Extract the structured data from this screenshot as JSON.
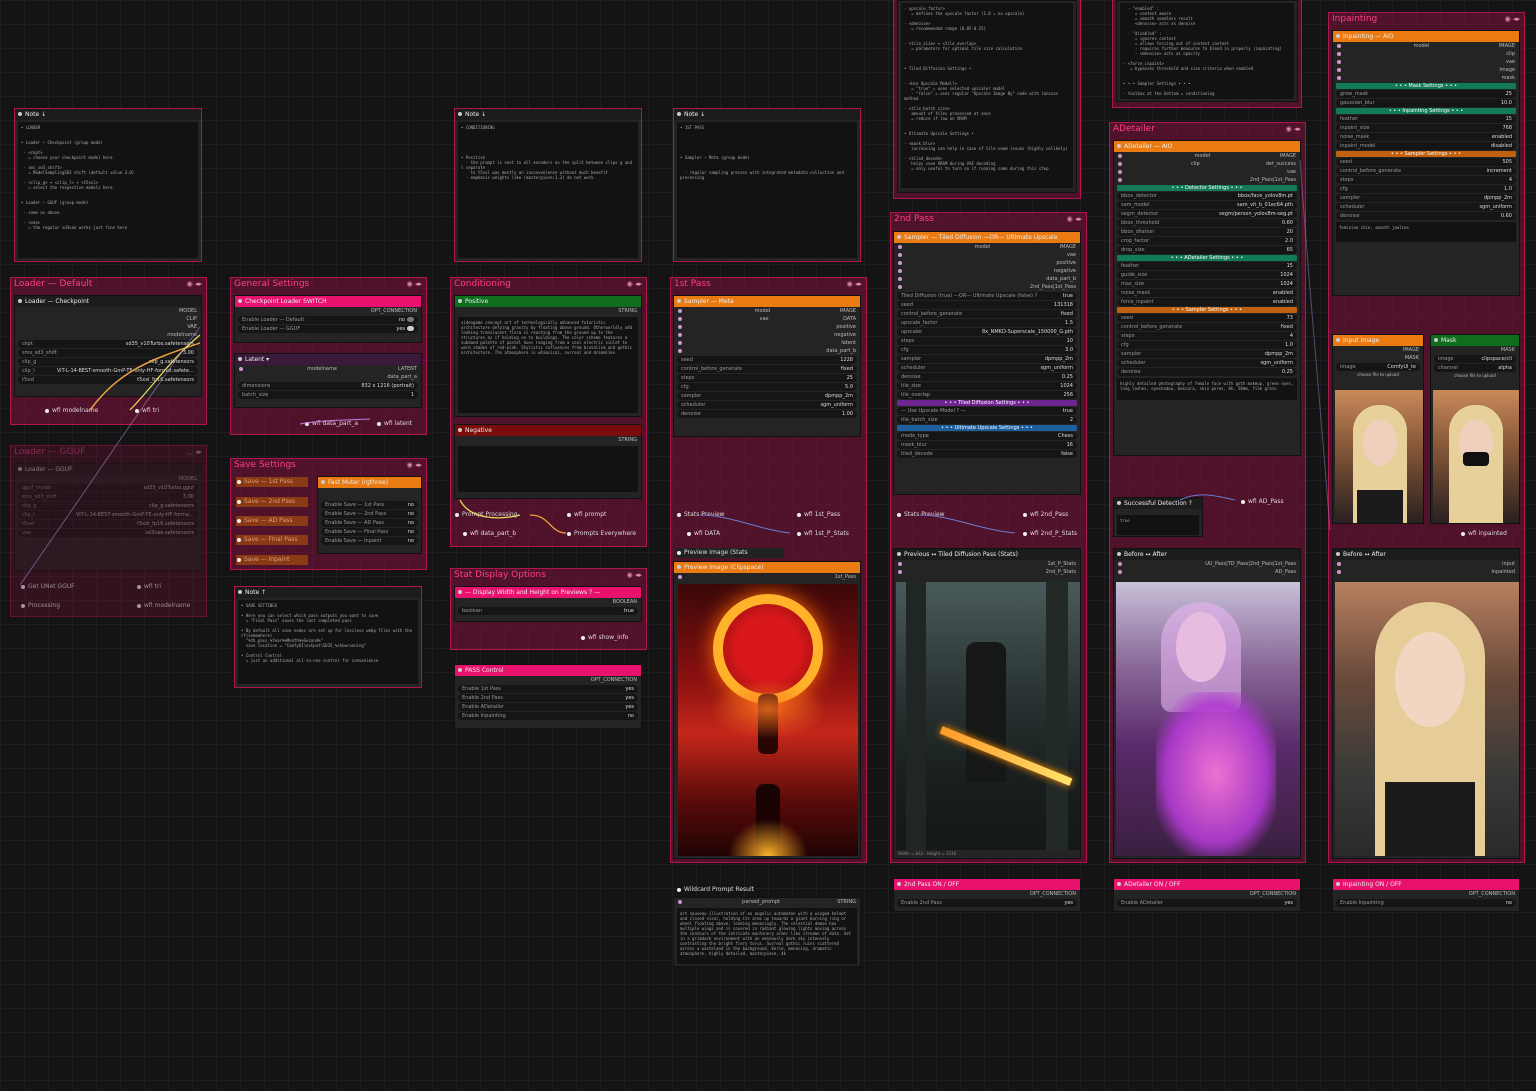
{
  "groups": {
    "loader_default": "Loader — Default",
    "loader_gguf": "Loader — GGUF",
    "general": "General Settings",
    "save": "Save Settings",
    "conditioning": "Conditioning",
    "stat": "Stat Display Options",
    "pass1": "1st Pass",
    "pass2": "2nd Pass",
    "adetailer": "ADetailer",
    "inpainting": "Inpainting"
  },
  "notes": {
    "note1": {
      "title": "Note ↓",
      "text": "• LOADER\n\n\n• Loader — Checkpoint (group mode)\n\n - <ckpt>\n   = choose your checkpoint model here\n\n - sms_sd3_shift>\n   = ModelSamplingSD3 shift (default value 3.0)\n\n - <clip_g> + <clip_l> + <t5xxl>\n   = select the respective models here\n\n\n• Loader — GGUF (group mode)\n\n - same as above\n\n - <vae>\n   = the regular sd3vae works just fine here"
    },
    "note2": {
      "title": "Note ↓",
      "text": "• CONDITIONING\n\n\n\n\n\n• Positive\n  - the prompt is sent to all encoders as the split between clips g and l separate\n    to t5xxl was mostly an inconvenience without much benefit\n  - emphasis weights like (masterpiece:1.3) do not work"
    },
    "note3": {
      "title": "Note ↓",
      "text": "• 1ST PASS\n\n\n\n\n\n• Sampler — Meta (group mode)\n\n\n  - regular sampling process with integrated metadata collection and processing"
    },
    "note4": {
      "title": "Note ↑",
      "text": "• SAVE SETTINGS\n\n• Here you can select which pass outputs you want to save\n  = \"Final Pass\" saves the last completed pass\n\n• By default all save nodes are set up for lossless webp files with the rf(somewhere)\n  \"%th_pass_%Year%%Month%%Second%\"\n  save location = \"ComfyUI\\output\\SD35_%showrunning\"\n\n• Control Control\n  = just an additional all-in-one control for convenience"
    },
    "note5": {
      "title": "",
      "text": "- upscale_factor>\n   = defines the upscale factor (1.0 = no upscale)\n\n- <denoise>\n   = recommended range (0.05-0.25)\n\n\n- <tile_size> + <tile_overlap>\n   = parameters for optimal tile size calculation\n\n\n\n• Tiled Diffusion Settings •\n\n\n- <Use Upscale Model?>\n   = \"true\" = uses selected upscaler model\n   - \"false\" = uses regular \"Upscale Image By\" node with lanczos method\n\n- <tile_batch_size>\n   amount of tiles processed at once\n   = reduce if low on VRAM\n\n\n• Ultimate Upscale Settings •\n\n- <mask_blur>\n   increasing can help in case of tile-seam issues (highly unlikely)\n\n- <tiled_decode>\n   helps save VRAM during VAE decoding\n   = only useful to turn on if running some during this step"
    },
    "note6": {
      "title": "",
      "text": "  - \"enabled\" :\n     = context aware\n     = smooth seamless result\n     <denoise> acts as denoise\n\n  - \"disabled\" :\n     = ignores context\n     = allows forcing out of context content\n     - requires further measures to blend in properly (inpainting)\n     - <denoise> acts as opacity\n\n- <force_inpaint>\n   = bypasses threshold and size criteria when enabled\n\n\n• • • Sampler Settings • • •\n\n- toolbox at the bottom = conditioning"
    }
  },
  "loader_ckpt": {
    "title": "Loader — Checkpoint",
    "outputs": [
      "MODEL",
      "CLIP",
      "VAE",
      "modelname"
    ],
    "widgets": [
      [
        "ckpt",
        "sd35_v10Turbo.safetensors"
      ],
      [
        "sms_sd3_shift",
        "3.00"
      ],
      [
        "clip_g",
        "clip_g.safetensors"
      ],
      [
        "clip_l",
        "ViT-L-14-BEST-smooth-GmP-TE-only-HF-format.safete…"
      ],
      [
        "t5xxl",
        "t5xxl_fp16.safetensors"
      ]
    ],
    "pills": [
      "wfi modelname",
      "wfi tri"
    ]
  },
  "loader_gguf": {
    "title": "Loader — GGUF",
    "outputs": [
      "MODEL"
    ],
    "widgets": [
      [
        "gguf_model",
        "sd35_v10Turbo.gguf"
      ],
      [
        "sms_sd3_shift",
        "3.00"
      ],
      [
        "clip_g",
        "clip_g.safetensors"
      ],
      [
        "clip_l",
        "ViT-L-14-BEST-smooth-GmP-TE-only-HF-forma…"
      ],
      [
        "t5xxl",
        "t5xxl_fp16.safetensors"
      ],
      [
        "vae",
        "sd3vae.safetensors"
      ]
    ],
    "pills": [
      "Get UNet GGUF",
      "wfi tri",
      "Processing",
      "wfi modelname"
    ]
  },
  "ckpt_switch": {
    "title": "Checkpoint Loader SWITCH",
    "out": "OPT_CONNECTION",
    "toggles": [
      [
        "Enable Loader — Default",
        "no"
      ],
      [
        "Enable Loader — GGUF",
        "yes"
      ]
    ]
  },
  "latent": {
    "title": "Latent ▾",
    "in": "modelname",
    "outs": [
      "LATENT",
      "data_part_a"
    ],
    "widgets": [
      [
        "dimensions",
        "832 x 1216 (portrait)"
      ],
      [
        "batch_size",
        "1"
      ]
    ],
    "pills": [
      "wfi data_part_a",
      "wfi latent"
    ]
  },
  "save_group": {
    "buttons": [
      "Save — 1st Pass",
      "Save — 2nd Pass",
      "Save — AD Pass",
      "Save — Final Pass",
      "Save — Inpaint"
    ],
    "muter": "Fast Muter (rgthree)",
    "toggles": [
      [
        "Enable Save — 1st Pass",
        "no"
      ],
      [
        "Enable Save — 2nd Pass",
        "no"
      ],
      [
        "Enable Save — AD Pass",
        "no"
      ],
      [
        "Enable Save — Final Pass",
        "no"
      ],
      [
        "Enable Save — Inpaint",
        "no"
      ]
    ]
  },
  "positive": {
    "title": "Positive",
    "out": "STRING",
    "text": "videogame concept art of technologically advanced futuristic architecture defying gravity by floating above ground. Otherworldly odd looking translucent flora is reaching from the ground up to the structures as if holding on to buildings. The color scheme features a subdued palette of pastel hues ranging from a cool electric violet to warm shades of red-pink. Stylistic influences from brutalism and gothic architecture. The atmosphere is whimsical, surreal and dreamlike"
  },
  "negative": {
    "title": "Negative",
    "out": "STRING"
  },
  "cond_pills": [
    "Prompt Processing",
    "wfi prompt",
    "wfi data_part_b",
    "Prompts Everywhere"
  ],
  "display_size": {
    "title": "— Display Width and Height on Previews ? —",
    "out": "BOOLEAN",
    "widget": [
      "boolean",
      "true"
    ],
    "pill": "wfi show_info"
  },
  "pass_control": {
    "title": "PASS Control",
    "out": "OPT_CONNECTION",
    "toggles": [
      [
        "Enable 1st Pass",
        "yes"
      ],
      [
        "Enable 2nd Pass",
        "yes"
      ],
      [
        "Enable ADetailer",
        "yes"
      ],
      [
        "Enable Inpainting",
        "no"
      ]
    ]
  },
  "sampler_meta": {
    "title": "Sampler — Meta",
    "ins": [
      "model",
      "vae",
      "positive",
      "negative",
      "latent",
      "data_part_b"
    ],
    "outs": [
      "IMAGE",
      "DATA"
    ],
    "widgets": [
      [
        "seed",
        "1228"
      ],
      [
        "control_before_generate",
        "fixed"
      ],
      [
        "steps",
        "25"
      ],
      [
        "cfg",
        "5.0"
      ],
      [
        "sampler",
        "dpmpp_2m"
      ],
      [
        "scheduler",
        "sgm_uniform"
      ],
      [
        "denoise",
        "1.00"
      ]
    ]
  },
  "pass1_pills": [
    "Stats Preview",
    "wfi 1st_Pass",
    "wfi DATA",
    "wfi 1st_P_Stats"
  ],
  "preview1": {
    "stats": "Preview Image (Stats",
    "clip": "Preview Image (Clipspace)",
    "input": "1st_Pass"
  },
  "wildcard": {
    "title": "Wildcard Prompt Result",
    "in": "parsed_prompt",
    "out": "STRING",
    "text": "art nouveau illustration of an angelic automaton with a winged helmet and closed visor, holding its arms up towards a giant burning ring or wheel floating above, looking menacingly. The celestial demon has multiple wings and is covered in radiant glowing lights moving across the contours of the intricate machinery armor like streams of data. Set in a grimdark environment with an ominously dark sky intensely contrasting the bright fiery torus. Surreal gothic ruins scattered across a wasteland in the background. Eerie, menacing, dramatic atmosphere, highly detailed, masterpiece, 4k"
  },
  "sampler_tiled": {
    "title": "Sampler — Tiled Diffusion —OR— Ultimate Upscale",
    "ins": [
      "model",
      "vae",
      "positive",
      "negative",
      "data_part_b",
      "2nd_Pass|1st_Pass"
    ],
    "out": "IMAGE",
    "widgets": [
      [
        "Tiled Diffusion (true) —OR— Ultimate Upscale (false) ?",
        "true"
      ],
      [
        "seed",
        "131318"
      ],
      [
        "control_before_generate",
        "fixed"
      ],
      [
        "upscale_factor",
        "1.5"
      ],
      [
        "upscaler",
        "8x_NMKD-Superscale_150000_G.pth"
      ],
      [
        "steps",
        "10"
      ],
      [
        "cfg",
        "3.0"
      ],
      [
        "sampler",
        "dpmpp_2m"
      ],
      [
        "scheduler",
        "sgm_uniform"
      ],
      [
        "denoise",
        "0.25"
      ],
      [
        "tile_size",
        "1024"
      ],
      [
        "tile_overlap",
        "256"
      ]
    ],
    "sect_tiled": "• • • Tiled Diffusion Settings • • •",
    "tiled_widgets": [
      [
        "— Use Upscale Model ? —",
        "true"
      ],
      [
        "tile_batch_size",
        "2"
      ]
    ],
    "sect_ult": "• • • Ultimate Upscale Settings • • •",
    "ult_widgets": [
      [
        "mode_type",
        "Chess"
      ],
      [
        "mask_blur",
        "16"
      ],
      [
        "tiled_decode",
        "false"
      ]
    ]
  },
  "pass2_pills": [
    "Stats Preview",
    "wfi 2nd_Pass",
    "wfi 2nd_P_Stats"
  ],
  "preview2": {
    "title": "Previous ↔ Tiled Diffusion Pass (Stats)",
    "ins": [
      "1st_P_Stats",
      "2nd_P_Stats"
    ],
    "caption": "Width = 832 · Height = 1216"
  },
  "adetailer_aio": {
    "title": "ADetailer — AIO",
    "ins": [
      "model",
      "clip",
      "vae",
      "2nd_Pass|1st_Pass"
    ],
    "outs": [
      "IMAGE",
      "det_success"
    ],
    "sect_det": "• • • Detector Settings • • •",
    "det": [
      [
        "bbox_detector",
        "bbox/face_yolov8m.pt"
      ],
      [
        "sam_model",
        "sam_vit_b_01ec64.pth"
      ],
      [
        "segm_detector",
        "segm/person_yolov8m-seg.pt"
      ],
      [
        "bbox_threshold",
        "0.60"
      ],
      [
        "bbox_dilation",
        "20"
      ],
      [
        "crop_factor",
        "2.0"
      ],
      [
        "drop_size",
        "65"
      ]
    ],
    "sect_ad": "• • • ADetailer Settings • • •",
    "ad": [
      [
        "feather",
        "15"
      ],
      [
        "guide_size",
        "1024"
      ],
      [
        "max_size",
        "1024"
      ],
      [
        "noise_mask",
        "enabled"
      ],
      [
        "force_inpaint",
        "enabled"
      ]
    ],
    "sect_samp": "• • • Sampler Settings • • •",
    "samp": [
      [
        "seed",
        "73"
      ],
      [
        "control_before_generate",
        "fixed"
      ],
      [
        "steps",
        "4"
      ],
      [
        "cfg",
        "1.0"
      ],
      [
        "sampler",
        "dpmpp_2m"
      ],
      [
        "scheduler",
        "sgm_uniform"
      ],
      [
        "denoise",
        "0.25"
      ]
    ],
    "text": "highly detailed photography of female face with goth makeup, green eyes, long lashes, eyeshadow, mascara, skin pores, 8k, 50mm, film grain"
  },
  "ad_pills": [
    "Successful Detection ?",
    "wfi AD_Pass"
  ],
  "ad_success": "true",
  "before_after_ad": {
    "title": "Before ↔ After",
    "ins": [
      "UU_Pass|TD_Pass|2nd_Pass|1st_Pass",
      "AD_Pass"
    ]
  },
  "inpaint_aio": {
    "title": "Inpainting — AIO",
    "ins": [
      "model",
      "clip",
      "vae",
      "image",
      "mask"
    ],
    "out": "IMAGE",
    "sect_mask": "• • • Mask Settings • • •",
    "mask": [
      [
        "grow_mask",
        "25"
      ],
      [
        "gaussian_blur",
        "10.0"
      ]
    ],
    "sect_inp": "• • • Inpainting Settings • • •",
    "inp": [
      [
        "feather",
        "15"
      ],
      [
        "inpaint_size",
        "768"
      ],
      [
        "noise_mask",
        "enabled"
      ],
      [
        "inpaint_model",
        "disabled"
      ]
    ],
    "sect_samp": "• • • Sampler Settings • • •",
    "samp": [
      [
        "seed",
        "505"
      ],
      [
        "control_before_generate",
        "increment"
      ],
      [
        "steps",
        "4"
      ],
      [
        "cfg",
        "1.0"
      ],
      [
        "sampler",
        "dpmpp_2m"
      ],
      [
        "scheduler",
        "sgm_uniform"
      ],
      [
        "denoise",
        "0.60"
      ]
    ],
    "text": "feminine chin, smooth jawline"
  },
  "input_image": {
    "title": "Input Image",
    "outs": [
      "IMAGE",
      "MASK"
    ],
    "widget": [
      "image",
      "ComfyUI_te"
    ],
    "upload": "choose file to upload"
  },
  "mask_node": {
    "title": "Mask",
    "outs": [
      "MASK"
    ],
    "widgets": [
      [
        "image",
        "clipspace/cli"
      ],
      [
        "channel",
        "alpha"
      ]
    ],
    "upload": "choose file to upload"
  },
  "inpaint_pill": "wfi inpainted",
  "before_after_inp": {
    "title": "Before ↔ After",
    "ins": [
      "input",
      "inpainted"
    ]
  },
  "onoff": {
    "p2": {
      "title": "2nd Pass ON / OFF",
      "out": "OPT_CONNECTION",
      "toggle": [
        "Enable 2nd Pass",
        "yes"
      ]
    },
    "ad": {
      "title": "ADetailer  ON / OFF",
      "out": "OPT_CONNECTION",
      "toggle": [
        "Enable ADetailer",
        "yes"
      ]
    },
    "inp": {
      "title": "Inpainting ON / OFF",
      "out": "OPT_CONNECTION",
      "toggle": [
        "Enable Inpainting",
        "no"
      ]
    }
  },
  "colors": {
    "group": "#b0154f",
    "accent_pink": "#e8116e",
    "accent_orange": "#ea7a12",
    "accent_green": "#0e6e1c",
    "teal": "#127a58",
    "purple": "#6f2590",
    "blue": "#1c5f9c"
  },
  "icons": {
    "group_controls": "eye-and-arrows-icon"
  }
}
